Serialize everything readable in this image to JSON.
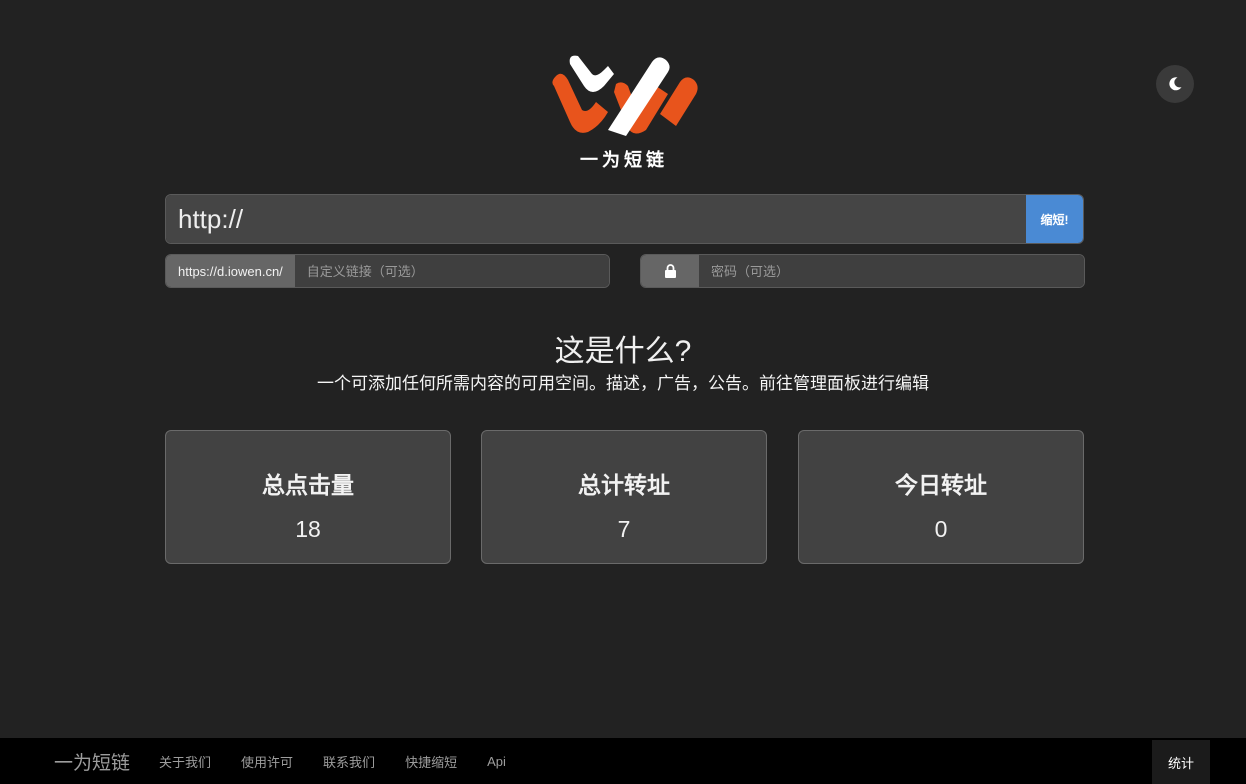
{
  "header": {
    "logo_text": "一为短链",
    "theme_toggle_icon": "moon-icon"
  },
  "shorten": {
    "url_value": "http://",
    "button_label": "缩短!",
    "domain_prefix": "https://d.iowen.cn/",
    "custom_placeholder": "自定义链接（可选）",
    "password_placeholder": "密码（可选）",
    "lock_icon": "lock-icon"
  },
  "about": {
    "title": "这是什么?",
    "description": "一个可添加任何所需内容的可用空间。描述，广告，公告。前往管理面板进行编辑"
  },
  "stats": [
    {
      "label": "总点击量",
      "value": "18"
    },
    {
      "label": "总计转址",
      "value": "7"
    },
    {
      "label": "今日转址",
      "value": "0"
    }
  ],
  "footer": {
    "brand": "一为短链",
    "links": [
      "关于我们",
      "使用许可",
      "联系我们",
      "快捷缩短",
      "Api"
    ],
    "stats_label": "统计"
  },
  "colors": {
    "background": "#222222",
    "accent": "#4a8ad4",
    "logo_orange": "#e8541c"
  }
}
